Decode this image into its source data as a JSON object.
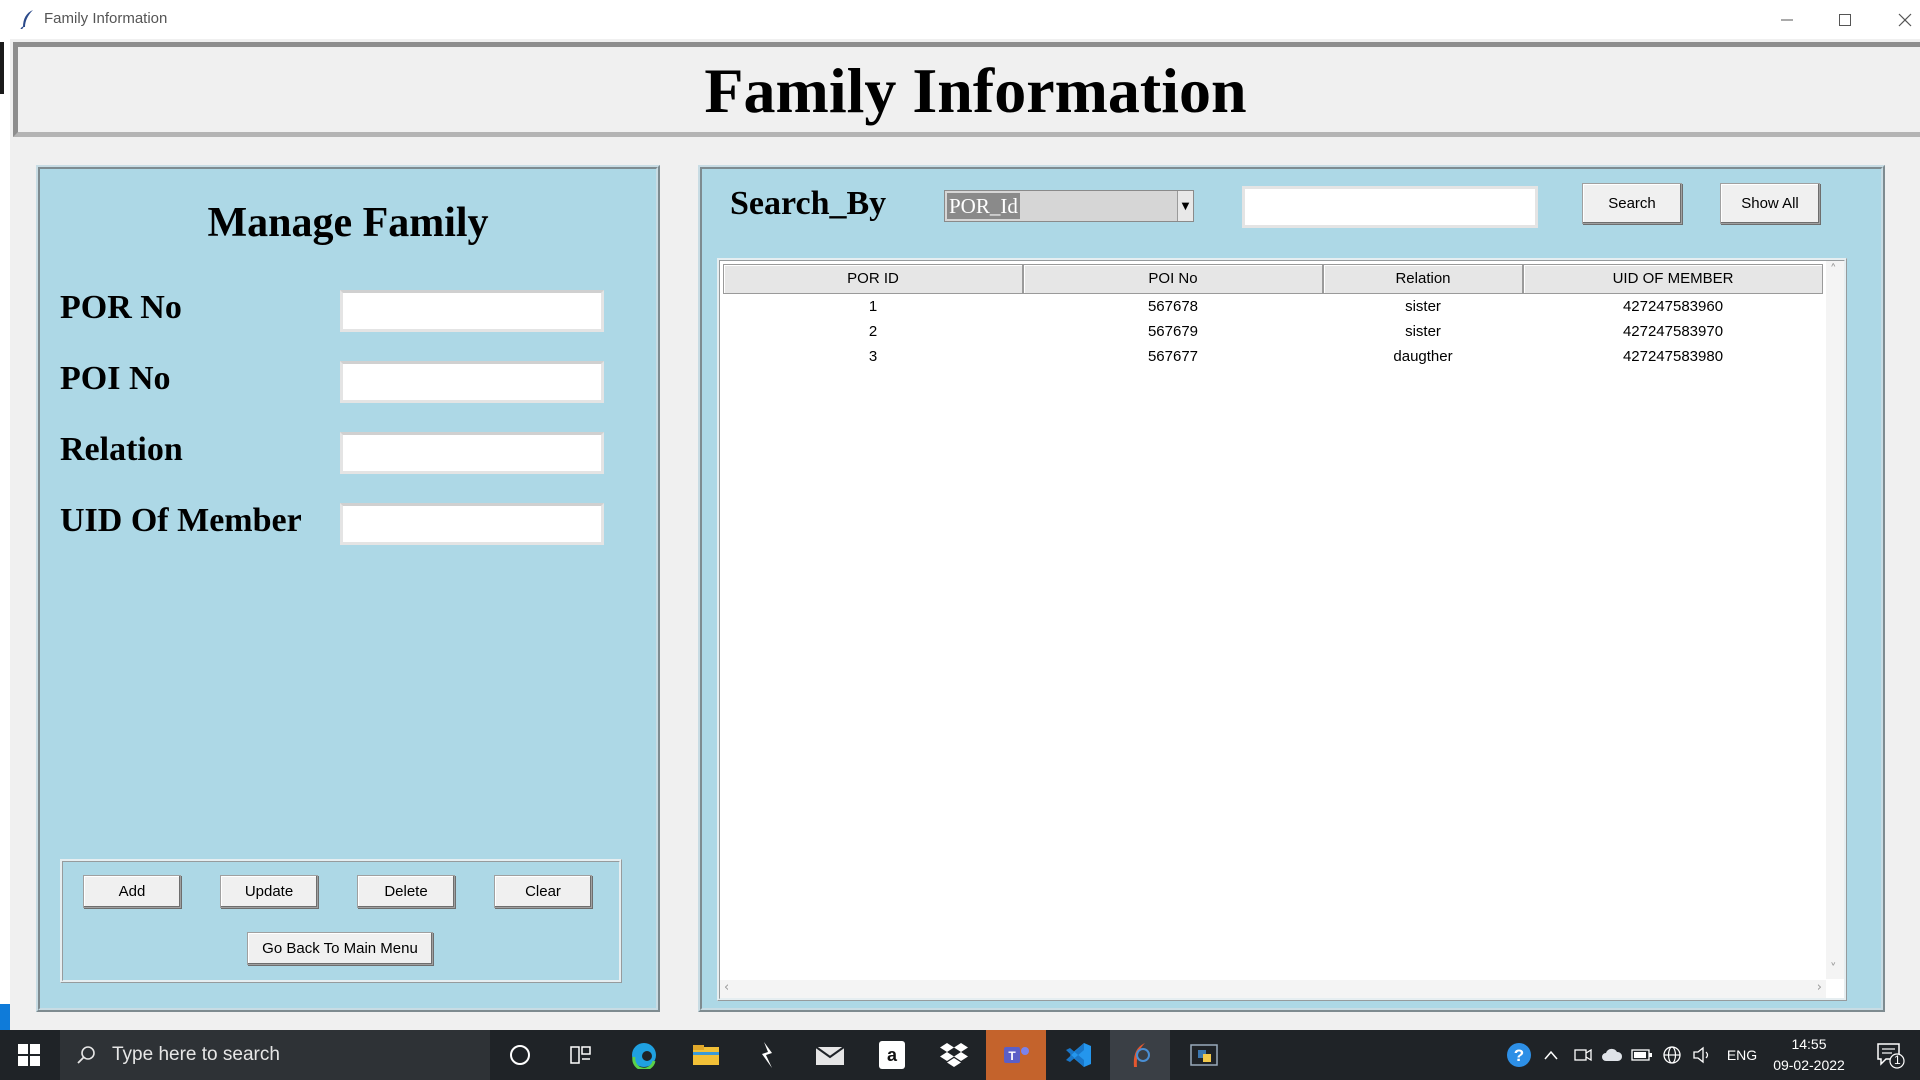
{
  "window": {
    "title": "Family Information",
    "heading": "Family Information"
  },
  "manage": {
    "title": "Manage Family",
    "fields": [
      {
        "label": "POR No",
        "value": ""
      },
      {
        "label": "POI No",
        "value": ""
      },
      {
        "label": "Relation",
        "value": ""
      },
      {
        "label": "UID Of Member",
        "value": ""
      }
    ],
    "buttons": {
      "add": "Add",
      "update": "Update",
      "delete": "Delete",
      "clear": "Clear",
      "back": "Go Back To Main Menu"
    }
  },
  "search": {
    "label": "Search_By",
    "selected": "POR_Id",
    "value": "",
    "search_button": "Search",
    "show_all_button": "Show All"
  },
  "table": {
    "columns": [
      "POR ID",
      "POI No",
      "Relation",
      "UID OF MEMBER"
    ],
    "rows": [
      [
        "1",
        "567678",
        "sister",
        "427247583960"
      ],
      [
        "2",
        "567679",
        "sister",
        "427247583970"
      ],
      [
        "3",
        "567677",
        "daugther",
        "427247583980"
      ]
    ]
  },
  "taskbar": {
    "search_placeholder": "Type here to search",
    "language": "ENG",
    "time": "14:55",
    "date": "09-02-2022",
    "notifications": "1"
  },
  "colors": {
    "panel_bg": "#add8e6",
    "window_bg": "#f0f0f0",
    "taskbar_bg": "#1f2327",
    "active_app_bg": "#c4632c"
  }
}
